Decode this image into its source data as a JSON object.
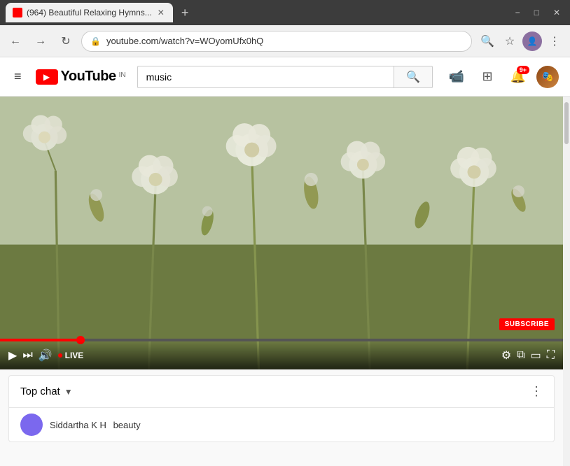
{
  "browser": {
    "title": "(964) Beautiful Relaxing Hymns...",
    "url": "youtube.com/watch?v=WOyomUfx0hQ",
    "new_tab_label": "+",
    "back_icon": "←",
    "forward_icon": "→",
    "refresh_icon": "↻",
    "search_icon": "🔍",
    "star_icon": "☆",
    "menu_icon": "⋮",
    "window_minimize": "−",
    "window_restore": "□",
    "window_close": "✕"
  },
  "youtube": {
    "logo_text": "YouTube",
    "country_code": "IN",
    "menu_icon": "≡",
    "search_placeholder": "music",
    "search_value": "music",
    "upload_icon": "📹",
    "apps_icon": "⊞",
    "notification_count": "9+",
    "avatar_initial": "🎭",
    "subscribe_label": "SUBSCRIBE",
    "live_label": "LIVE",
    "chat_title": "Top chat",
    "chat_dropdown_icon": "▼",
    "chat_more_icon": "⋮",
    "chat_username": "Siddartha K H",
    "chat_message": "beauty"
  },
  "video": {
    "title": "Beautiful Relaxing Hymns",
    "progress_percent": 15
  },
  "colors": {
    "youtube_red": "#ff0000",
    "background": "#f9f9f9",
    "header_bg": "#ffffff",
    "text_primary": "#030303"
  }
}
